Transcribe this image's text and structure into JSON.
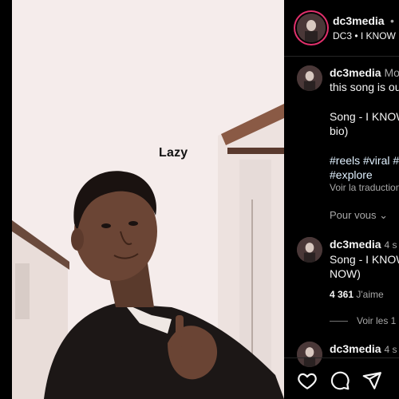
{
  "media": {
    "caption_overlay": "Lazy"
  },
  "header": {
    "username": "dc3media",
    "separator": "•",
    "subtitle": "DC3 • I KNOW"
  },
  "caption": {
    "username": "dc3media",
    "meta": "Mo",
    "line1": "this song is ou",
    "line2": "Song - I KNOW",
    "line3": "bio)",
    "hashtags_line1": "#reels #viral #",
    "hashtags_line2": "#explore",
    "see_translation": "Voir la traduction",
    "pour_vous": "Pour vous ⌄"
  },
  "comment1": {
    "username": "dc3media",
    "time": "4 s",
    "line1": "Song - I KNOW",
    "line2": "NOW)",
    "likes_count": "4 361",
    "likes_label": "J'aime",
    "view_replies": "Voir les 1"
  },
  "comment2": {
    "username": "dc3media",
    "time": "4 s"
  },
  "actions": {
    "like": "heart-icon",
    "comment": "comment-icon",
    "share": "share-icon"
  },
  "colors": {
    "panel_bg": "#000000",
    "story_ring": "#e1306c",
    "link": "#e0f1ff",
    "muted": "#a8a8a8"
  }
}
